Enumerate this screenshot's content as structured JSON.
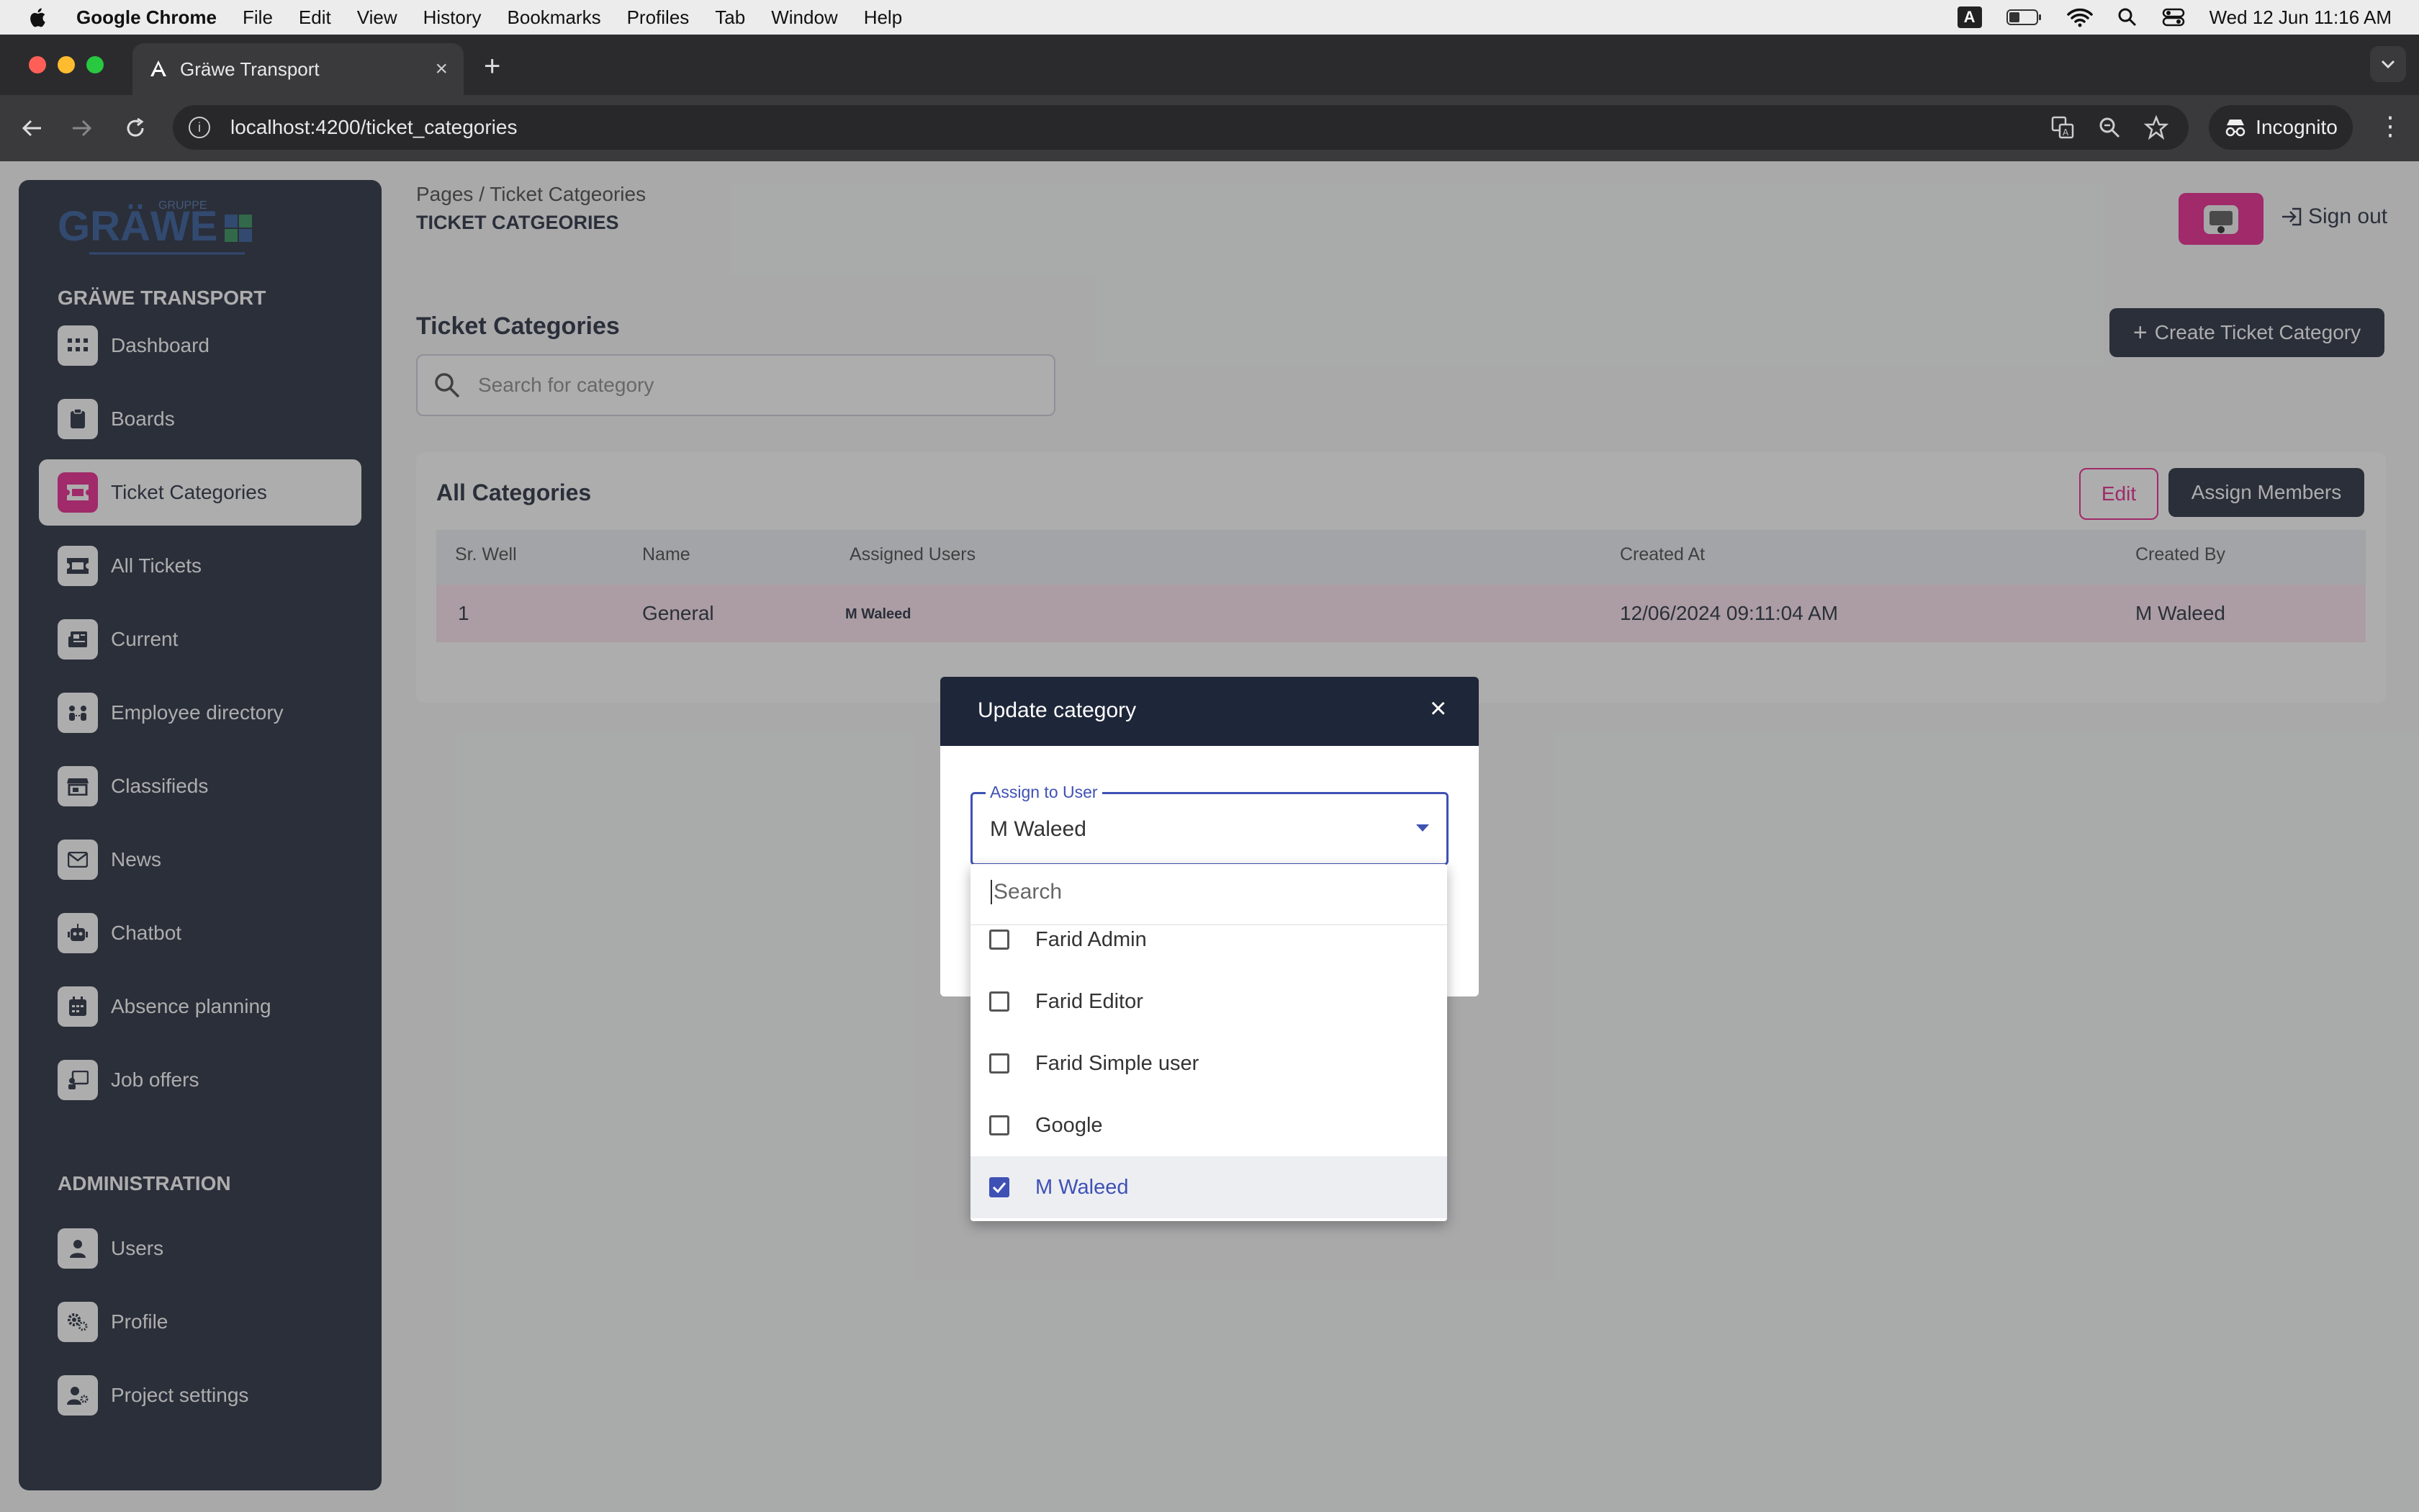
{
  "menubar": {
    "app": "Google Chrome",
    "items": [
      "File",
      "Edit",
      "View",
      "History",
      "Bookmarks",
      "Profiles",
      "Tab",
      "Window",
      "Help"
    ],
    "keyboard_badge": "A",
    "datetime": "Wed 12 Jun  11:16 AM"
  },
  "browser": {
    "tab_title": "Gräwe Transport",
    "url": "localhost:4200/ticket_categories",
    "incognito_label": "Incognito"
  },
  "sidebar": {
    "brand": "GRÄWE TRANSPORT",
    "items": [
      {
        "label": "Dashboard",
        "icon": "grid-icon"
      },
      {
        "label": "Boards",
        "icon": "clipboard-icon"
      },
      {
        "label": "Ticket Categories",
        "icon": "ticket-icon",
        "active": true
      },
      {
        "label": "All Tickets",
        "icon": "ticket-icon"
      },
      {
        "label": "Current",
        "icon": "newspaper-icon"
      },
      {
        "label": "Employee directory",
        "icon": "people-icon"
      },
      {
        "label": "Classifieds",
        "icon": "store-icon"
      },
      {
        "label": "News",
        "icon": "mail-icon"
      },
      {
        "label": "Chatbot",
        "icon": "robot-icon"
      },
      {
        "label": "Absence planning",
        "icon": "calendar-icon"
      },
      {
        "label": "Job offers",
        "icon": "job-icon"
      }
    ],
    "admin_title": "ADMINISTRATION",
    "admin_items": [
      {
        "label": "Users",
        "icon": "user-icon"
      },
      {
        "label": "Profile",
        "icon": "gears-icon"
      },
      {
        "label": "Project settings",
        "icon": "user-gear-icon"
      }
    ]
  },
  "header": {
    "breadcrumb_root": "Pages",
    "breadcrumb_current": "/ Ticket Catgeories",
    "title": "TICKET CATGEORIES",
    "signout": "Sign out"
  },
  "main": {
    "heading": "Ticket Categories",
    "create_button": "Create Ticket Category",
    "search_placeholder": "Search for category",
    "card_title": "All Categories",
    "edit_button": "Edit",
    "assign_button": "Assign Members",
    "columns": [
      "Sr. Well",
      "Name",
      "Assigned Users",
      "Created At",
      "Created By"
    ],
    "rows": [
      {
        "sr": "1",
        "name": "General",
        "users": "M Waleed",
        "created_at": "12/06/2024 09:11:04 AM",
        "created_by": "M Waleed"
      }
    ]
  },
  "dialog": {
    "title": "Update category",
    "field_label": "Assign to User",
    "field_value": "M Waleed",
    "search_placeholder": "Search",
    "options": [
      {
        "label": "Farid Admin",
        "checked": false
      },
      {
        "label": "Farid Editor",
        "checked": false
      },
      {
        "label": "Farid Simple user",
        "checked": false
      },
      {
        "label": "Google",
        "checked": false
      },
      {
        "label": "M Waleed",
        "checked": true
      }
    ]
  },
  "colors": {
    "navy": "#1e2639",
    "accent_pink": "#e91e8c",
    "indigo": "#3f51b5"
  }
}
